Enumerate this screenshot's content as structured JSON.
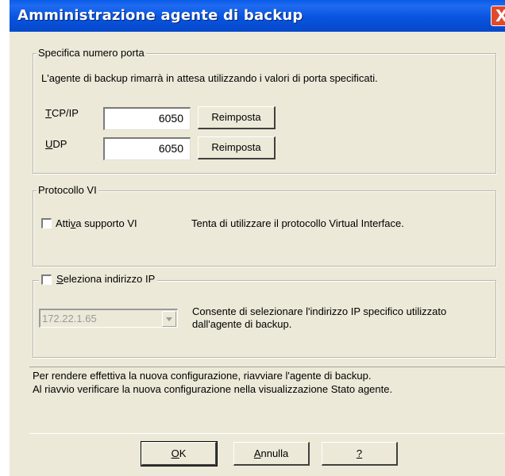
{
  "window": {
    "title": "Amministrazione agente di backup",
    "close_glyph": "X"
  },
  "ports": {
    "legend": "Specifica numero porta",
    "description": "L'agente di backup rimarrà in attesa utilizzando i valori di porta specificati.",
    "tcp_label_first": "T",
    "tcp_label_rest": "CP/IP",
    "tcp_value": "6050",
    "tcp_reset_label": "Reimposta",
    "udp_label_first": "U",
    "udp_label_rest": "DP",
    "udp_value": "6050",
    "udp_reset_label": "Reimposta"
  },
  "vi": {
    "legend": "Protocollo VI",
    "checkbox_label_a": "Atti",
    "checkbox_label_u": "v",
    "checkbox_label_b": "a supporto VI",
    "checked": false,
    "description": "Tenta di utilizzare il protocollo Virtual Interface."
  },
  "ip": {
    "checkbox_label_u": "S",
    "checkbox_label_rest": "eleziona indirizzo IP",
    "checked": false,
    "selected_ip": "172.22.1.65",
    "description_line1": "Consente di selezionare l'indirizzo IP specifico utilizzato",
    "description_line2": "dall'agente di backup."
  },
  "info": {
    "line1": "Per rendere effettiva la nuova configurazione, riavviare l'agente di backup.",
    "line2": "Al riavvio verificare la nuova configurazione nella visualizzazione Stato agente."
  },
  "buttons": {
    "ok_u": "O",
    "ok_rest": "K",
    "cancel_u": "A",
    "cancel_rest": "nnulla",
    "help_label": "?"
  },
  "colors": {
    "titlebar": "#0854e0",
    "dialog_bg": "#ece9d8",
    "close_button": "#e04a2b"
  }
}
